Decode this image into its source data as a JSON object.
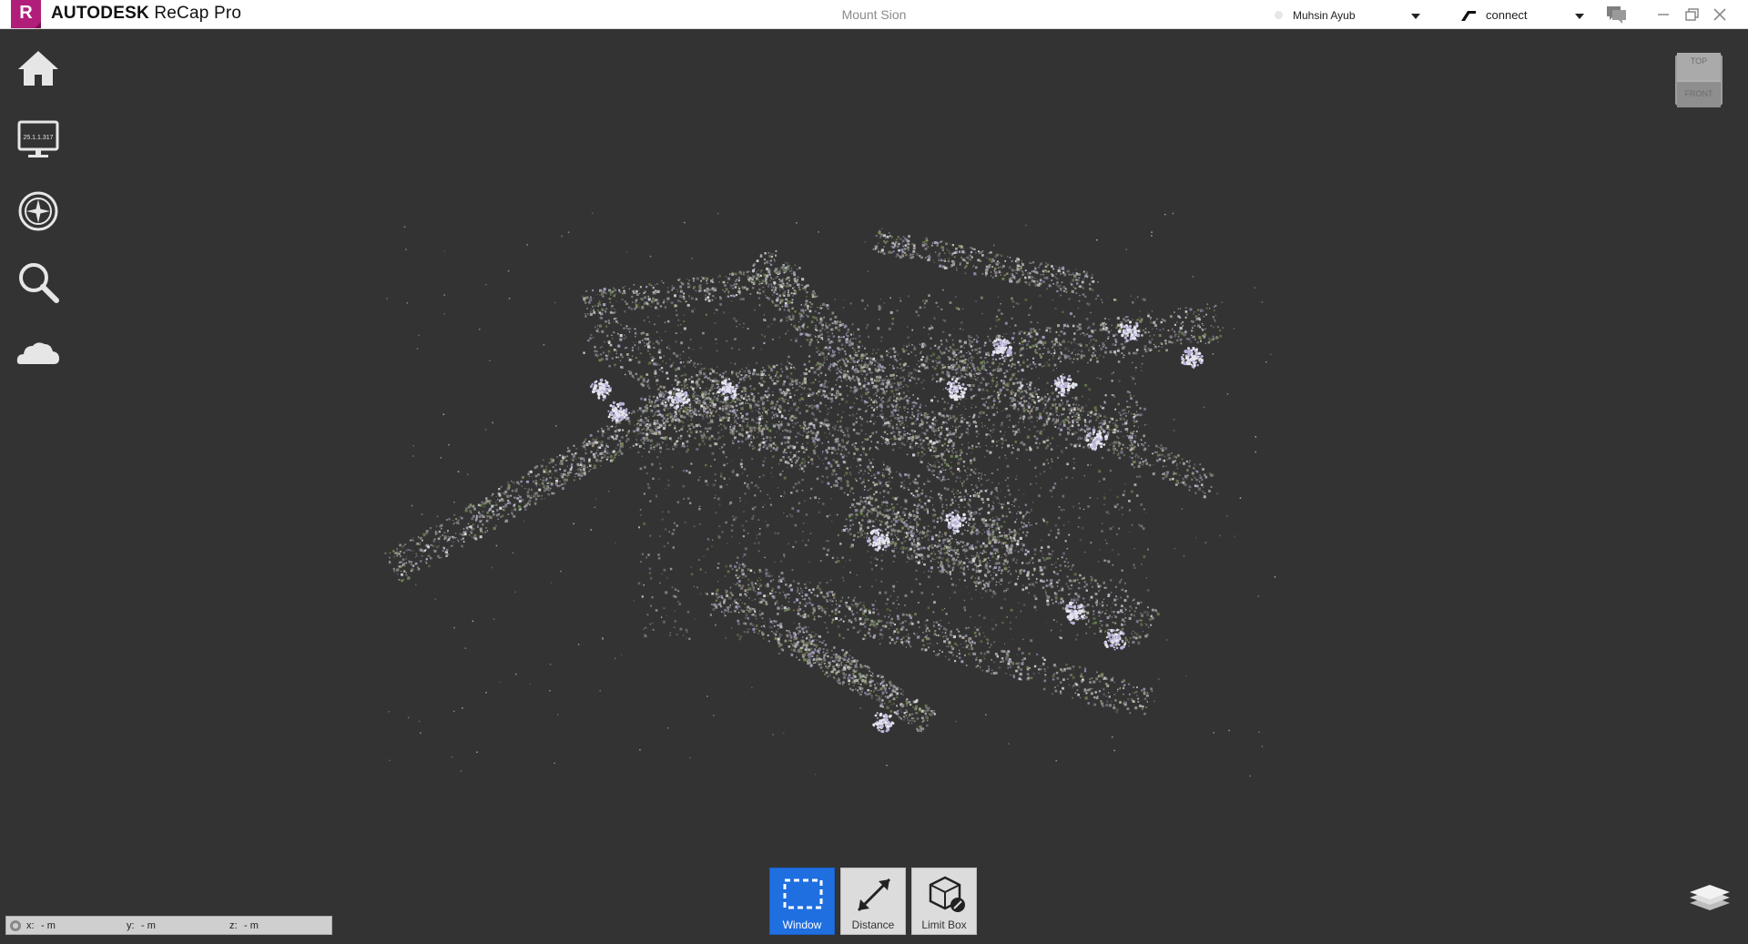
{
  "app": {
    "logo_letter": "R",
    "brand": "AUTODESK",
    "product": "ReCap Pro",
    "project_title": "Mount Sion"
  },
  "user": {
    "name": "Muhsin Ayub"
  },
  "connect": {
    "label": "connect"
  },
  "sidebar": {
    "items": [
      {
        "name": "home",
        "icon": "home-icon"
      },
      {
        "name": "display",
        "icon": "monitor-icon",
        "caption": "25.1.1.317"
      },
      {
        "name": "navigation",
        "icon": "compass-icon"
      },
      {
        "name": "search",
        "icon": "search-icon"
      },
      {
        "name": "cloud",
        "icon": "cloud-icon"
      }
    ]
  },
  "viewcube": {
    "top_label": "TOP",
    "front_label": "FRONT"
  },
  "toolbar": {
    "window_label": "Window",
    "distance_label": "Distance",
    "limitbox_label": "Limit Box",
    "active": "window"
  },
  "status": {
    "x_label": "x:",
    "x_value": "- m",
    "y_label": "y:",
    "y_value": "- m",
    "z_label": "z:",
    "z_value": "- m"
  },
  "colors": {
    "viewport_bg": "#333333",
    "active_tool": "#1f6fe0",
    "logo": "#b01e7a"
  }
}
